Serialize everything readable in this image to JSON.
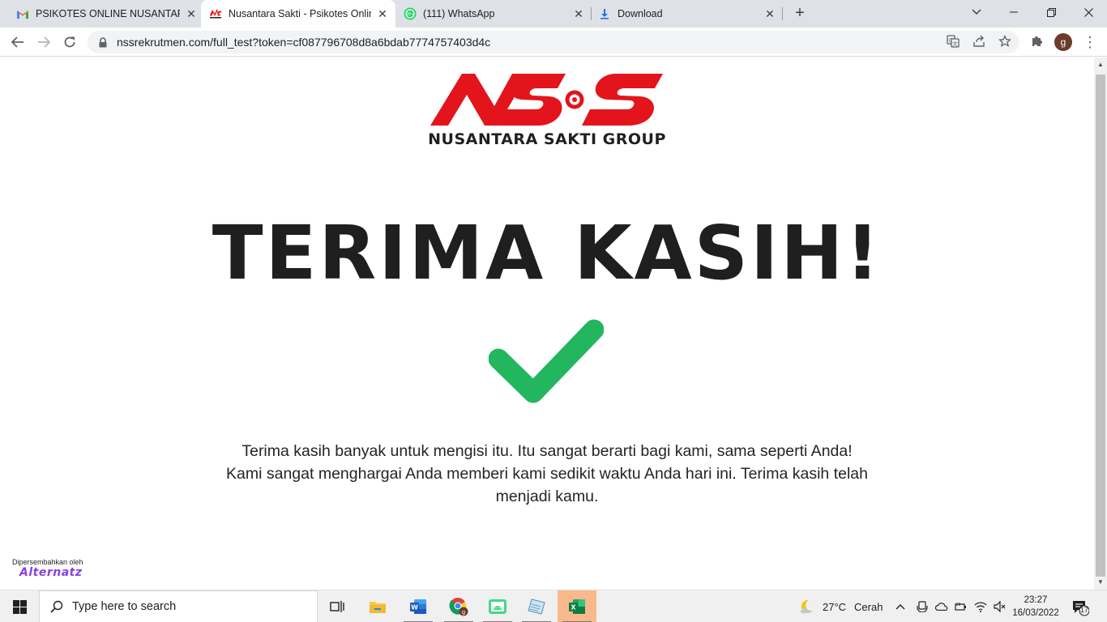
{
  "browser": {
    "tabs": [
      {
        "title": "PSIKOTES ONLINE NUSANTARA S",
        "icon": "gmail-icon",
        "active": false
      },
      {
        "title": "Nusantara Sakti - Psikotes Online",
        "icon": "nss-favicon",
        "active": true
      },
      {
        "title": "(111) WhatsApp",
        "icon": "whatsapp-icon",
        "active": false
      },
      {
        "title": "Download",
        "icon": "download-icon",
        "active": false
      }
    ],
    "url": "nssrekrutmen.com/full_test?token=cf087796708d8a6bdab7774757403d4c",
    "profile_initial": "g"
  },
  "page": {
    "logo_text": "NUSANTARA SAKTI GROUP",
    "headline": "TERIMA KASIH!",
    "message_line1": "Terima kasih banyak untuk mengisi itu. Itu sangat berarti bagi kami, sama seperti Anda!",
    "message_line2": "Kami sangat menghargai Anda memberi kami sedikit waktu Anda hari ini. Terima kasih telah menjadi kamu.",
    "credit_label": "Dipersembahkan oleh",
    "credit_brand": "Alternatz",
    "colors": {
      "logo_red": "#e3141c",
      "check_green": "#22b65f",
      "headline": "#1f1f1f",
      "brand_purple": "#8a3fe0"
    }
  },
  "taskbar": {
    "search_placeholder": "Type here to search",
    "apps": [
      "task-view",
      "file-explorer",
      "word",
      "chrome",
      "android-studio",
      "notepad",
      "excel"
    ],
    "weather_temp": "27°C",
    "weather_text": "Cerah",
    "time": "23:27",
    "date": "16/03/2022",
    "notification_count": "17"
  }
}
